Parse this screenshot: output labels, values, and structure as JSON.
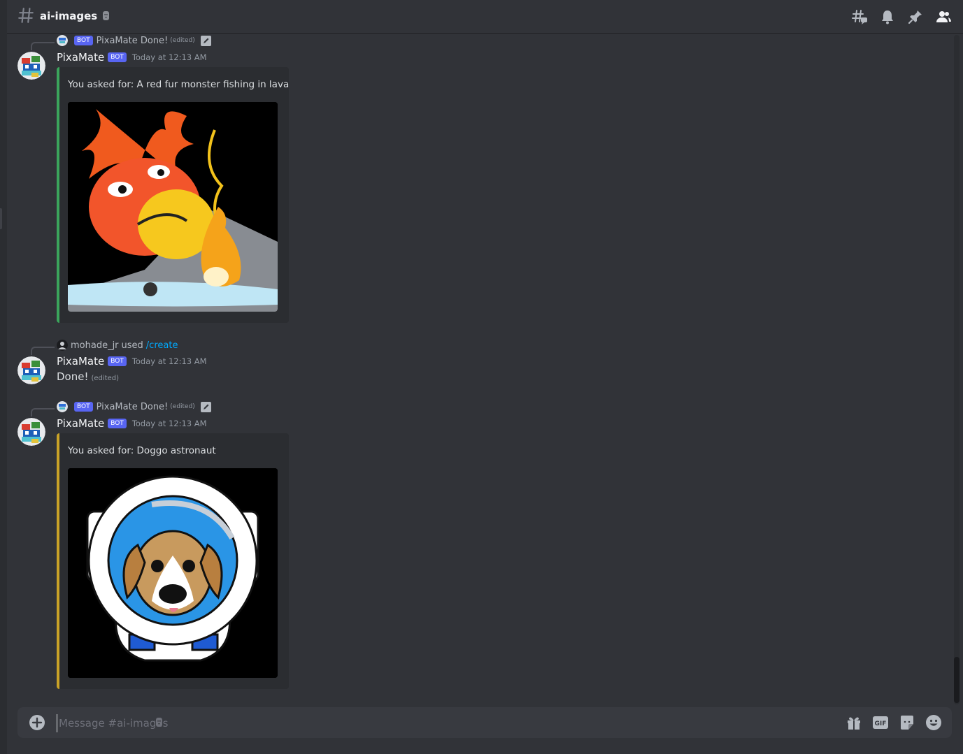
{
  "header": {
    "channel_name": "ai-images",
    "icons": [
      "threads-icon",
      "bell-icon",
      "pin-icon",
      "members-icon"
    ]
  },
  "messages": [
    {
      "reply": {
        "bot_tag": "BOT",
        "text": "PixaMate Done!",
        "edited": "(edited)",
        "icon": "pencil-icon"
      },
      "author": "PixaMate",
      "bot_tag": "BOT",
      "timestamp": "Today at 12:13 AM",
      "embed": {
        "description": "You asked for: A red fur monster fishing in lava",
        "accent": "#3ba55c"
      }
    },
    {
      "reply": {
        "user": "mohade_jr",
        "used": "used",
        "command": "/create"
      },
      "author": "PixaMate",
      "bot_tag": "BOT",
      "timestamp": "Today at 12:13 AM",
      "content": "Done!",
      "edited": "(edited)"
    },
    {
      "reply": {
        "bot_tag": "BOT",
        "text": "PixaMate Done!",
        "edited": "(edited)",
        "icon": "pencil-icon"
      },
      "author": "PixaMate",
      "bot_tag": "BOT",
      "timestamp": "Today at 12:13 AM",
      "embed": {
        "description": "You asked for: Doggo astronaut",
        "accent": "#c9a227"
      }
    }
  ],
  "composer": {
    "placeholder": "Message #ai-images",
    "icons": [
      "gift-icon",
      "gif-icon",
      "sticker-icon",
      "emoji-icon"
    ],
    "gif_label": "GIF"
  },
  "colors": {
    "background": "#313338",
    "embed_bg": "#2b2d31",
    "blurple": "#5865f2",
    "link": "#00a8fc"
  }
}
